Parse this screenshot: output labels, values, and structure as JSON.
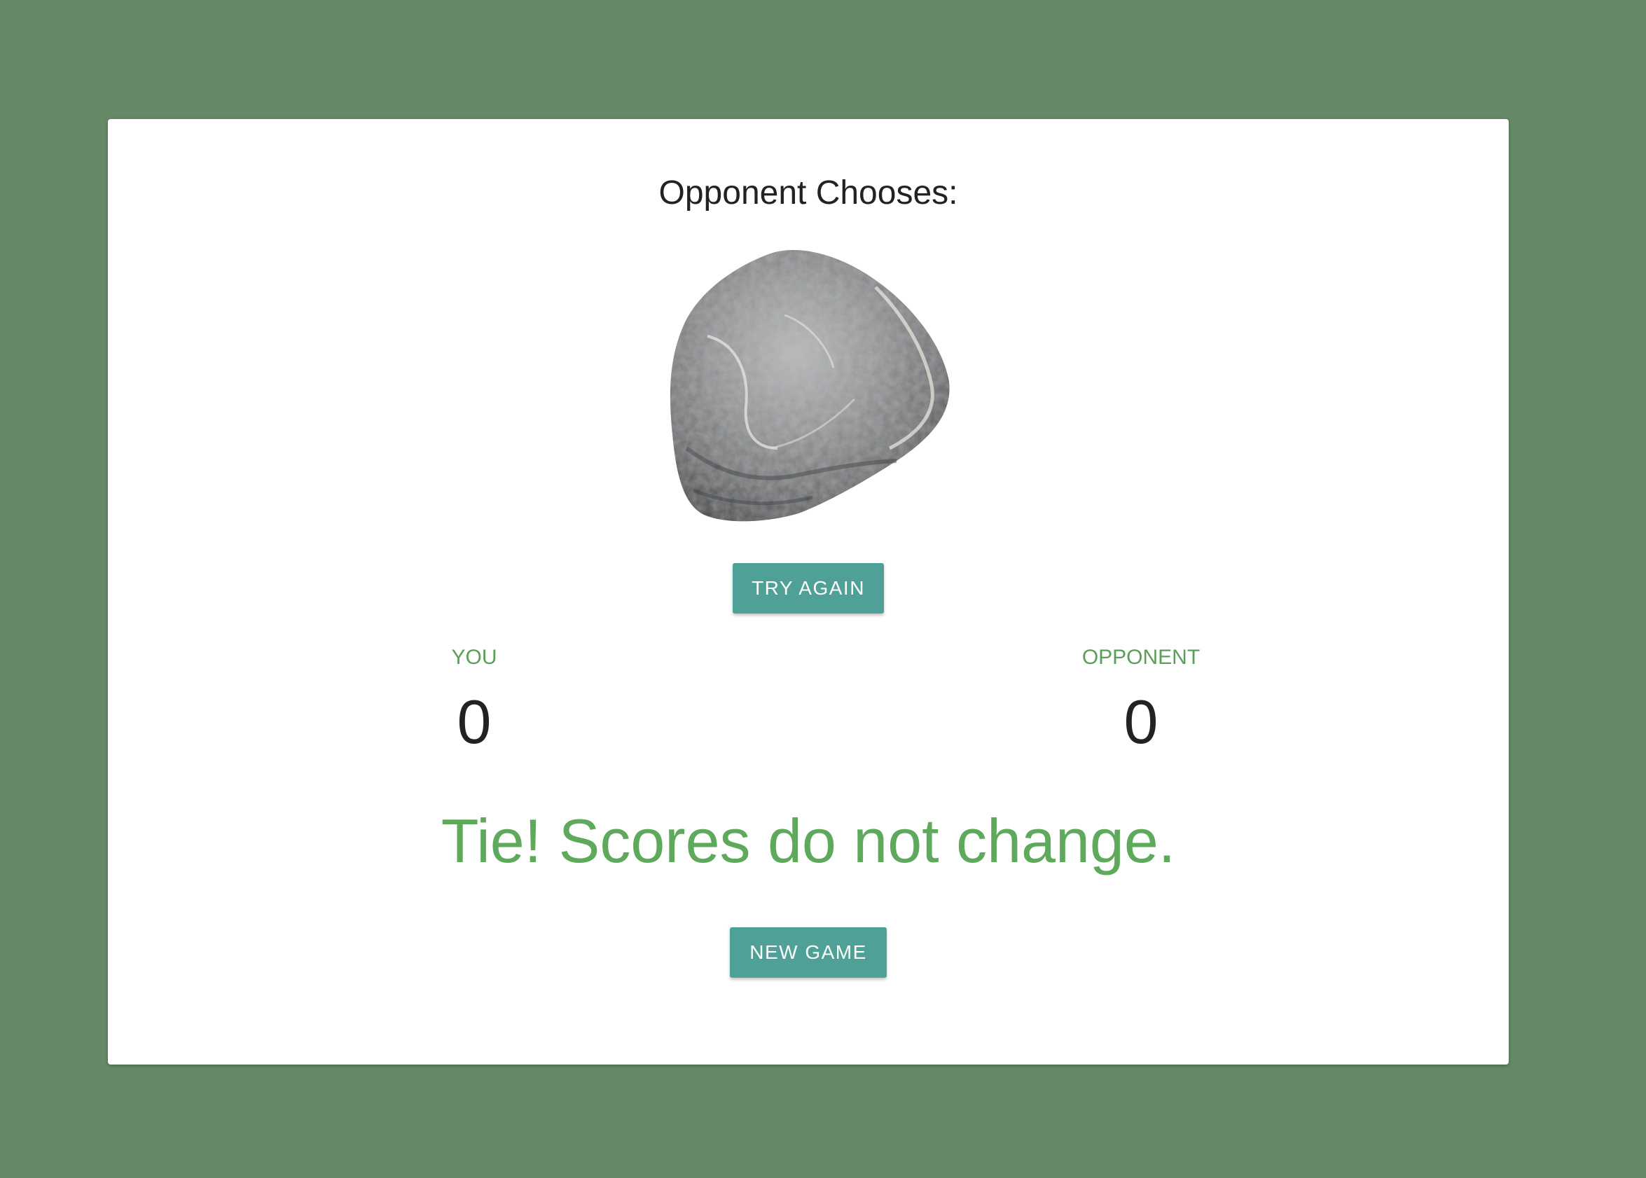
{
  "game": {
    "title": "Opponent Chooses:",
    "opponent_choice_icon": "rock-image",
    "try_again_label": "TRY AGAIN",
    "result_message": "Tie! Scores do not change.",
    "new_game_label": "NEW GAME"
  },
  "scores": {
    "you_label": "YOU",
    "you_value": "0",
    "opponent_label": "OPPONENT",
    "opponent_value": "0"
  },
  "colors": {
    "background": "#668a68",
    "card": "#ffffff",
    "button": "#4fa198",
    "accent_green": "#5ea95b",
    "text_dark": "#222222"
  }
}
